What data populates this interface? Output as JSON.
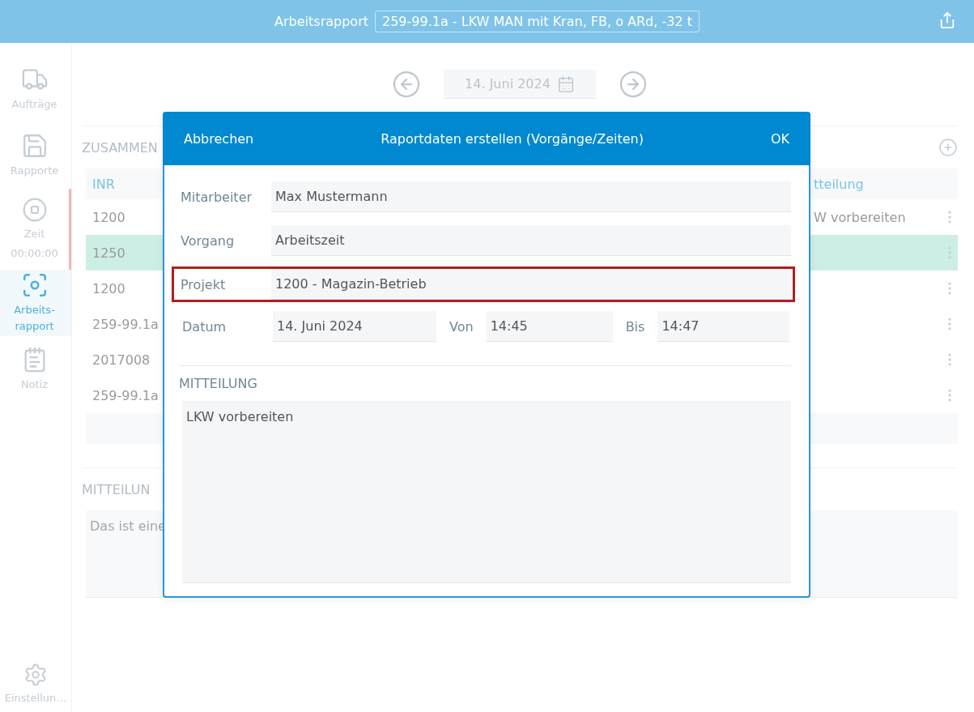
{
  "header": {
    "title": "Arbeitsrapport",
    "document": "259-99.1a - LKW MAN mit Kran, FB, o ARd, -32 t"
  },
  "sidebar": {
    "items": [
      {
        "kind": "truck",
        "label": "Aufträge",
        "selected": false,
        "indicator": false
      },
      {
        "kind": "report",
        "label": "Rapporte",
        "selected": false,
        "indicator": false
      },
      {
        "kind": "timer",
        "label": "Zeit",
        "sublabel": "00:00:00",
        "selected": false,
        "indicator": true
      },
      {
        "kind": "scan",
        "label": "Arbeits-\nrapport",
        "selected": true,
        "indicator": false
      },
      {
        "kind": "note",
        "label": "Notiz",
        "selected": false,
        "indicator": false
      }
    ],
    "settings": {
      "label": "Einstellun…"
    }
  },
  "date_nav": {
    "date": "14. Juni 2024"
  },
  "summary": {
    "heading": "ZUSAMMEN",
    "columns": [
      "INR",
      "tteilung"
    ],
    "rows": [
      {
        "column_1": "1200",
        "column_2": "W vorbereiten",
        "selected": false
      },
      {
        "column_1": "1250",
        "selected": true
      },
      {
        "column_1": "1200",
        "selected": false
      },
      {
        "column_1": "259-99.1a",
        "selected": false
      },
      {
        "column_1": "2017008",
        "selected": false
      },
      {
        "column_1": "259-99.1a",
        "selected": false
      }
    ]
  },
  "message": {
    "heading": "MITTEILUN",
    "text": "Das ist eine"
  },
  "dialog": {
    "cancel": "Abbrechen",
    "title": "Raportdaten erstellen (Vorgänge/Zeiten)",
    "confirm": "OK",
    "fields": [
      {
        "label": "Mitarbeiter",
        "value": "Max Mustermann",
        "highlighted": false
      },
      {
        "label": "Vorgang",
        "value": "Arbeitszeit",
        "highlighted": false
      },
      {
        "label": "Projekt",
        "value": "1200 - Magazin-Betrieb",
        "highlighted": true
      }
    ],
    "date_row": [
      {
        "label": "Datum",
        "value": "14. Juni 2024"
      },
      {
        "label": "Von",
        "value": "14:45"
      },
      {
        "label": "Bis",
        "value": "14:47"
      }
    ],
    "message": {
      "heading": "MITTEILUNG",
      "value": "LKW vorbereiten"
    }
  }
}
